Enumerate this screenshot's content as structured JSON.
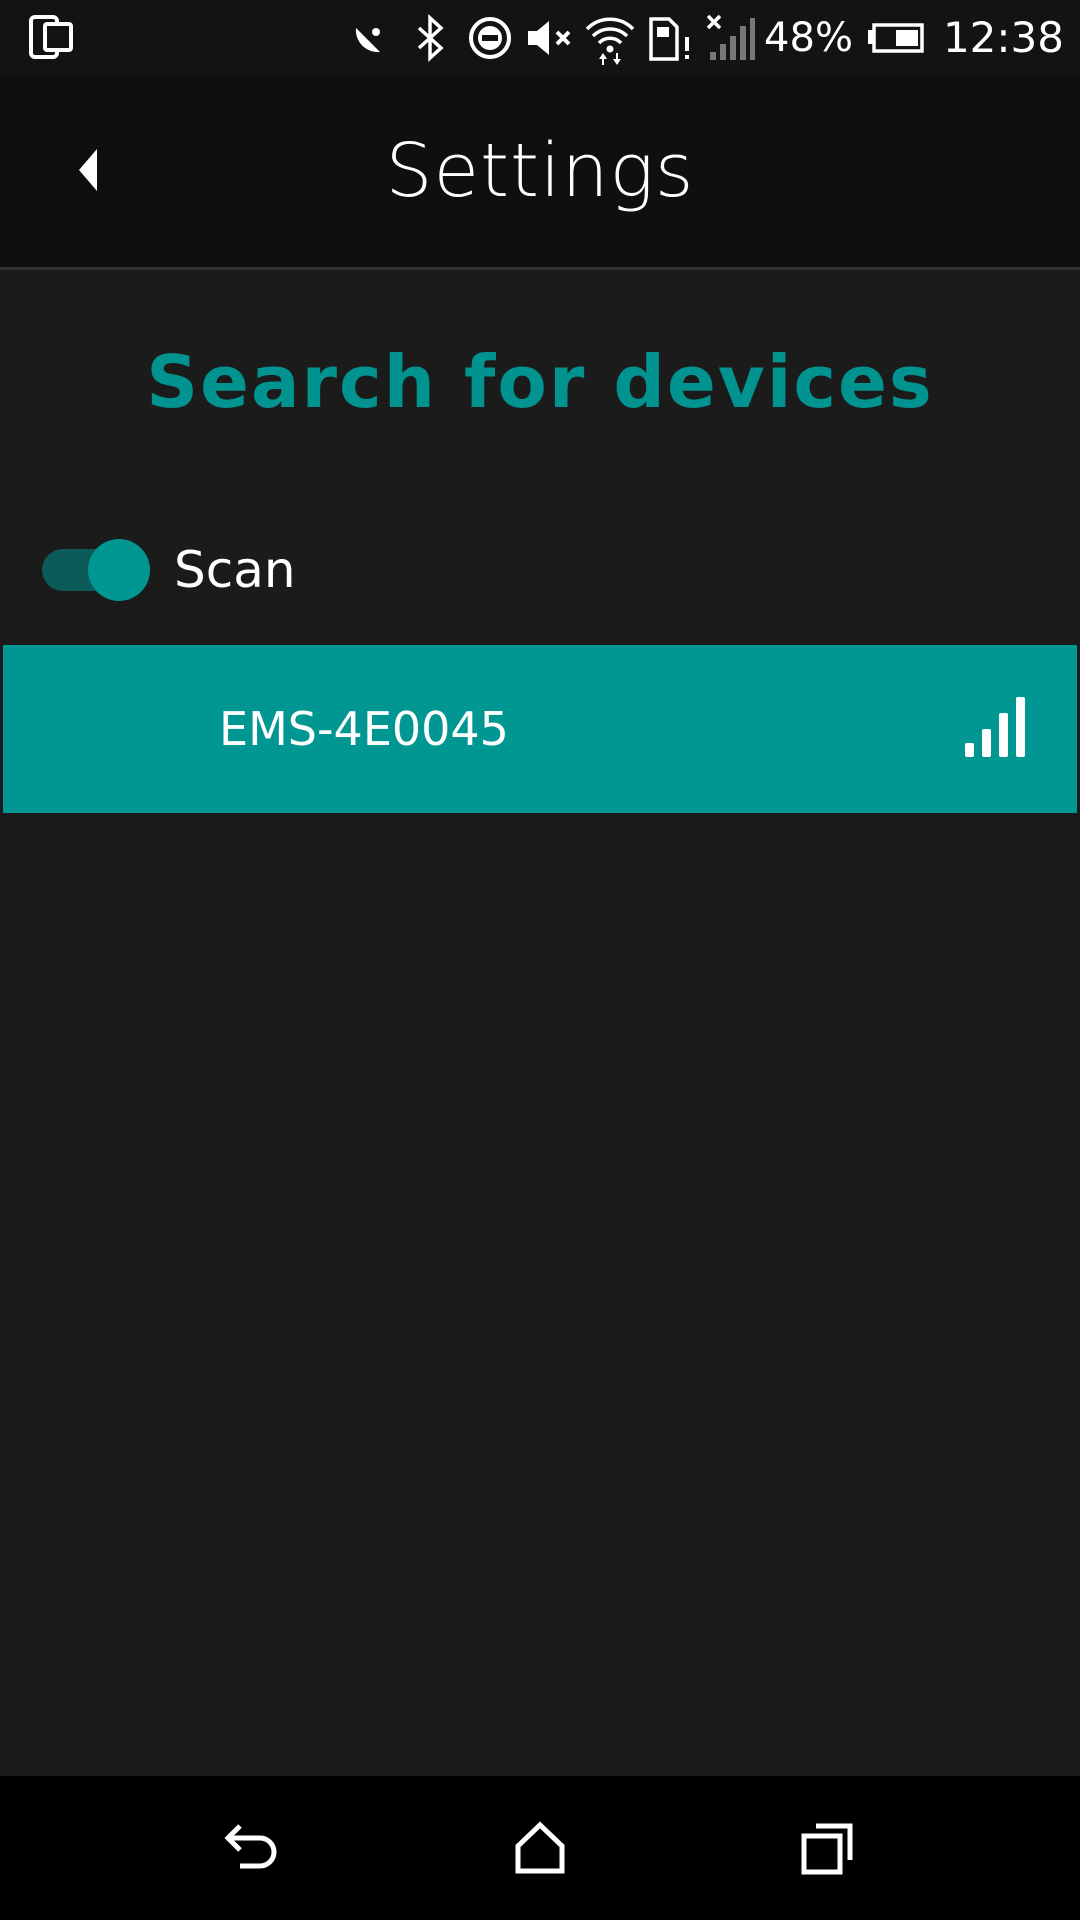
{
  "status_bar": {
    "icons": [
      "screen-mirror-icon",
      "satellite-dish-icon",
      "bluetooth-icon",
      "do-not-disturb-icon",
      "volume-muted-icon",
      "wifi-icon",
      "sim-card-alert-icon",
      "no-signal-icon",
      "battery-icon"
    ],
    "battery_percent": "48%",
    "time": "12:38"
  },
  "toolbar": {
    "title": "Settings",
    "back_icon": "back-arrow-icon"
  },
  "heading": "Search for devices",
  "scan": {
    "label": "Scan",
    "enabled": true
  },
  "devices": [
    {
      "name": "EMS-4E0045",
      "signal_icon": "signal-strength-icon",
      "signal_level": "4/4"
    }
  ],
  "nav_bar": {
    "buttons": [
      "back-icon",
      "home-icon",
      "recents-icon"
    ]
  },
  "colors": {
    "accent": "#00938f",
    "list_highlight": "#009793",
    "background": "#1b1b1b",
    "toolbar": "#0f0f0f"
  }
}
